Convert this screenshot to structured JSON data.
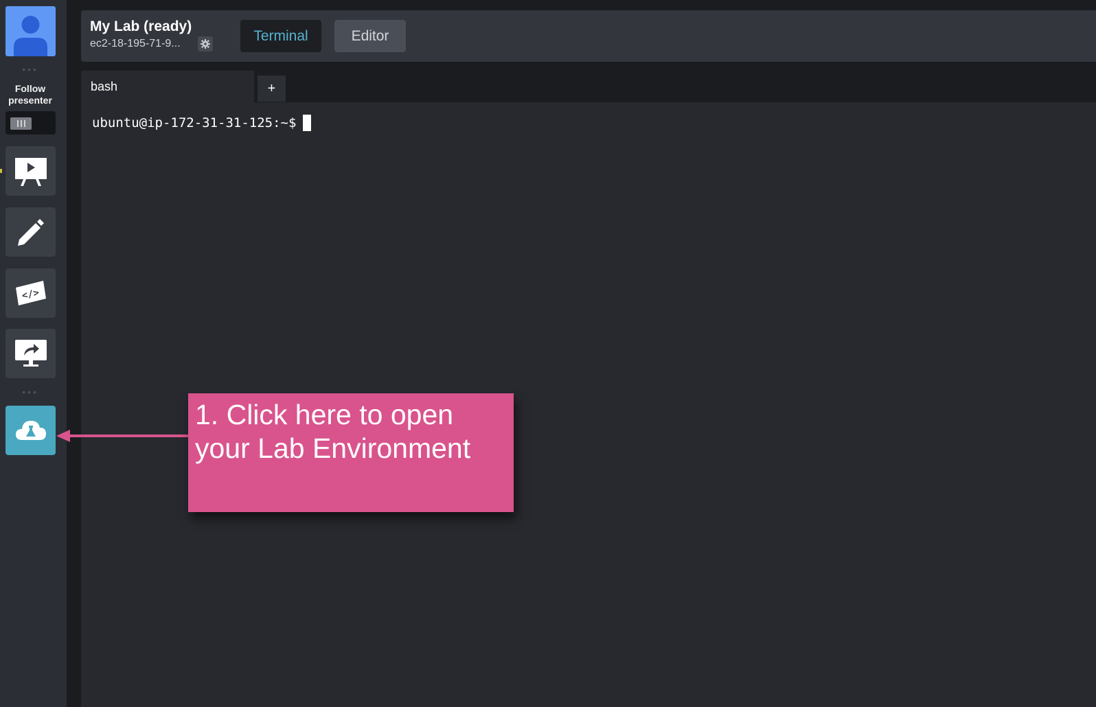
{
  "sidebar": {
    "follow_label_line1": "Follow",
    "follow_label_line2": "presenter",
    "items": [
      {
        "icon": "presentation-icon",
        "active": false
      },
      {
        "icon": "pencil-icon",
        "active": false
      },
      {
        "icon": "code-ticket-icon",
        "active": false
      },
      {
        "icon": "screen-share-icon",
        "active": false
      },
      {
        "icon": "cloud-lab-icon",
        "active": true
      }
    ]
  },
  "header": {
    "lab_title": "My Lab (ready)",
    "lab_host": "ec2-18-195-71-9...",
    "tabs": [
      {
        "label": "Terminal",
        "active": true
      },
      {
        "label": "Editor",
        "active": false
      }
    ]
  },
  "terminal": {
    "tab_label": "bash",
    "add_tab_label": "+",
    "prompt": "ubuntu@ip-172-31-31-125:~$"
  },
  "annotation": {
    "line1": "1. Click here to open",
    "line2": "your Lab Environment"
  },
  "colors": {
    "accent": "#4aa8c1",
    "callout": "#d9548c",
    "terminal_tab_text": "#56b3cf"
  }
}
